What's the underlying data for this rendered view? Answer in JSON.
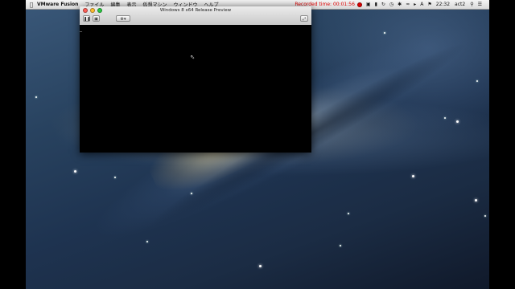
{
  "menubar": {
    "app_name": "VMware Fusion",
    "menu_items": [
      "ファイル",
      "編集",
      "表示",
      "仮想マシン",
      "ウィンドウ",
      "ヘルプ"
    ],
    "recording_label": "Recorded time: 00:01:56",
    "clock": "22:32",
    "user": "act2",
    "input_indicator": "A"
  },
  "vm_window": {
    "title": "Windows 8 x64 Release Preview"
  },
  "colors": {
    "recording": "#dd0000",
    "close_light": "#ff5f57",
    "minimize_light": "#ffbd2e",
    "zoom_light": "#28c940"
  }
}
